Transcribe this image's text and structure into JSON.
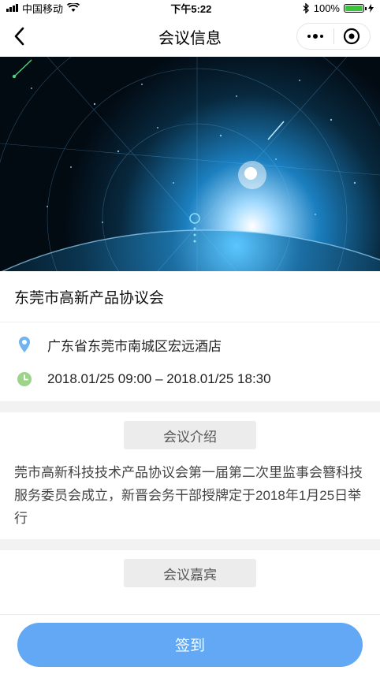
{
  "status_bar": {
    "carrier": "中国移动",
    "time": "下午5:22",
    "battery": "100%",
    "battery_level": 1.0
  },
  "nav": {
    "title": "会议信息"
  },
  "meeting": {
    "name": "东莞市高新产品协议会",
    "address": "广东省东莞市南城区宏远酒店",
    "time_range": "2018.01/25 09:00 – 2018.01/25 18:30"
  },
  "intro_section": {
    "heading": "会议介绍",
    "text": "莞市高新科技技术产品协议会第一届第二次里监事会簪科技服务委员会成立，新晋会务干部授牌定于2018年1月25日举行"
  },
  "guests_section": {
    "heading": "会议嘉宾"
  },
  "bottom": {
    "checkin_label": "签到"
  },
  "colors": {
    "accent": "#62a8f5",
    "location_icon": "#6fb3f2",
    "clock_icon": "#9ed38a"
  },
  "icons": [
    "wifi-icon",
    "bluetooth-icon",
    "charging-icon",
    "back-arrow-icon",
    "more-icon",
    "close-mini-program-icon",
    "location-pin-icon",
    "clock-icon"
  ]
}
